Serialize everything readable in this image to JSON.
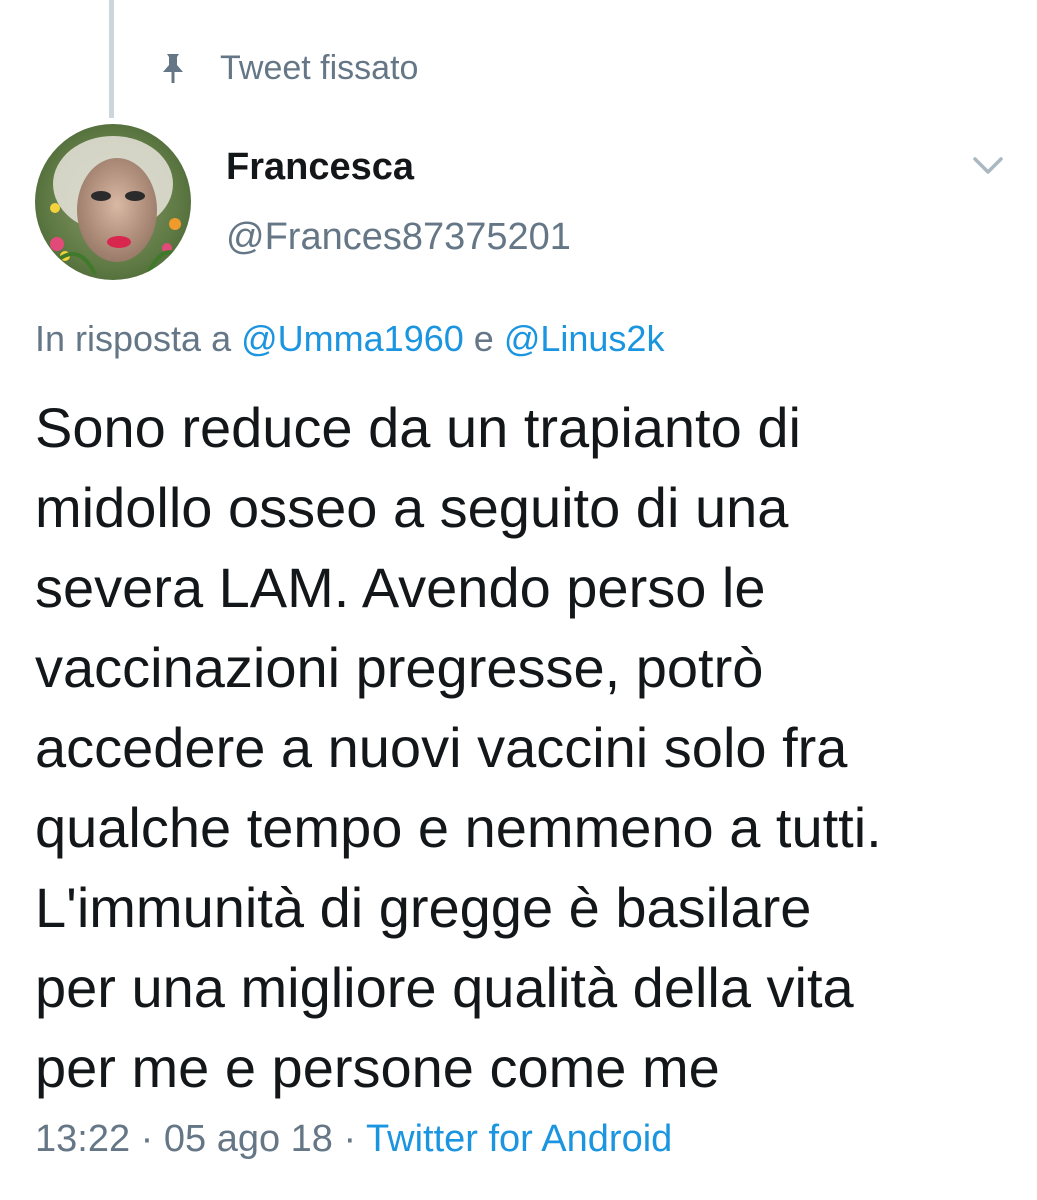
{
  "pinned": {
    "label": "Tweet fissato",
    "icon": "pin-icon"
  },
  "author": {
    "display_name": "Francesca",
    "handle": "@Frances87375201"
  },
  "menu_icon": "chevron-down-icon",
  "reply_context": {
    "prefix": "In risposta a",
    "mention_1": "@Umma1960",
    "conjunction": "e",
    "mention_2": "@Linus2k"
  },
  "tweet": {
    "lines": [
      "Sono reduce da un trapianto di",
      "midollo osseo a seguito di una",
      "severa LAM. Avendo perso le",
      "vaccinazioni pregresse, potrò",
      "accedere a nuovi vaccini solo fra",
      "qualche tempo e nemmeno a tutti.",
      "L'immunità di gregge è basilare",
      "per una migliore qualità della vita",
      "per me e persone come me"
    ]
  },
  "meta": {
    "time": "13:22",
    "separator_1": "·",
    "date": "05 ago 18",
    "separator_2": "·",
    "source": "Twitter for Android"
  },
  "colors": {
    "text": "#14171a",
    "secondary": "#657786",
    "link": "#1b95e0",
    "thread_line": "#ccd6dd"
  }
}
